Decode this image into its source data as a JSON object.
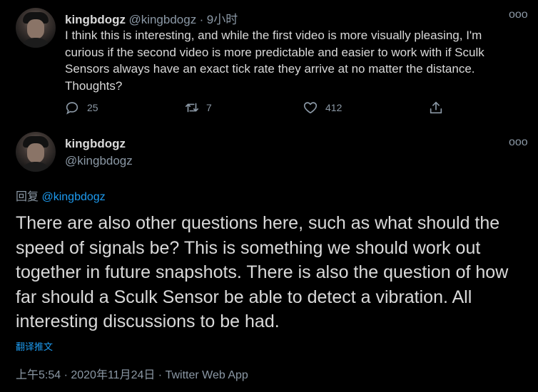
{
  "tweet1": {
    "name": "kingbdogz",
    "handle": "@kingbdogz",
    "separator": "·",
    "time": "9小时",
    "text": "I think this is interesting, and while the first video is more visually pleasing, I'm curious if the second video is more predictable and easier to work with if Sculk Sensors always have an exact tick rate they arrive at no matter the distance. Thoughts?",
    "more": "ooo",
    "actions": {
      "replies": "25",
      "retweets": "7",
      "likes": "412"
    }
  },
  "tweet2": {
    "name": "kingbdogz",
    "handle": "@kingbdogz",
    "more": "ooo",
    "reply_prefix": "回复",
    "reply_handle": "@kingbdogz",
    "text": "There are also other questions here, such as what should the speed of signals be? This is something we should work out together in future snapshots. There is also the question of how far should a Sculk Sensor be able to detect a vibration. All interesting discussions to be had.",
    "translate": "翻译推文",
    "timestamp": "上午5:54 · 2020年11月24日 · Twitter Web App"
  },
  "colors": {
    "background": "#000000",
    "text": "#d9d9d9",
    "secondary": "#8b98a5",
    "link": "#1d9bf0",
    "divider": "#2f3336"
  }
}
